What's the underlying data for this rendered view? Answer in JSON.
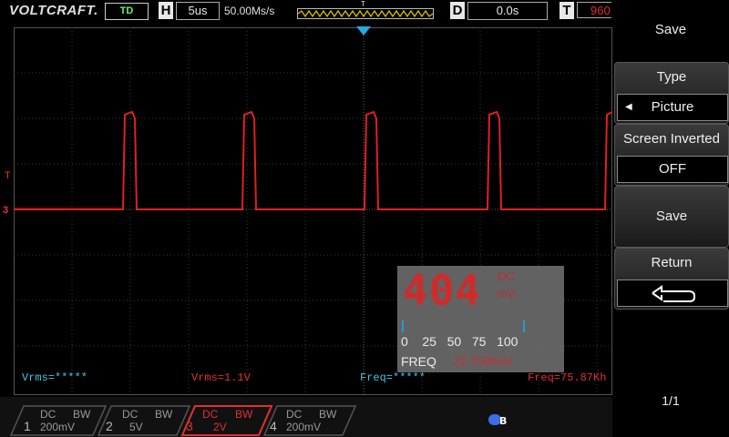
{
  "header": {
    "brand": "VOLTCRAFT.",
    "mode": "TD",
    "h_letter": "H",
    "timebase": "5us",
    "sample_rate": "50.00Ms/s",
    "trig_letter": "T",
    "d_letter": "D",
    "delay": "0.0s",
    "t_letter": "T",
    "trig_value": "960"
  },
  "measurements": {
    "m1": "Vrms=*****",
    "m2": "Vrms=1.1V",
    "m3": "Freq=*****",
    "m4": "Freq=75.87Kh"
  },
  "channel_marker": "3",
  "trigger_marker": "T",
  "meter": {
    "reading": "404",
    "coupling": "DC",
    "unit": "mV",
    "scale": "0    25   50   75   100",
    "freq_label": "FREQ",
    "freq_value": "22.756KHz"
  },
  "channels": [
    {
      "num": "1",
      "coupling": "DC",
      "bw": "BW",
      "scale": "200mV",
      "active": false
    },
    {
      "num": "2",
      "coupling": "DC",
      "bw": "BW",
      "scale": "5V",
      "active": false
    },
    {
      "num": "3",
      "coupling": "DC",
      "bw": "BW",
      "scale": "2V",
      "active": true
    },
    {
      "num": "4",
      "coupling": "DC",
      "bw": "BW",
      "scale": "200mV",
      "active": false
    }
  ],
  "menu": {
    "title": "Save",
    "type_label": "Type",
    "type_value": "Picture",
    "inverted_label": "Screen Inverted",
    "inverted_value": "OFF",
    "save_label": "Save",
    "return_label": "Return",
    "page": "1/1"
  },
  "colors": {
    "trace": "#e02020",
    "cyan": "#3fc6e6",
    "accent_blue": "#29a9e0"
  }
}
